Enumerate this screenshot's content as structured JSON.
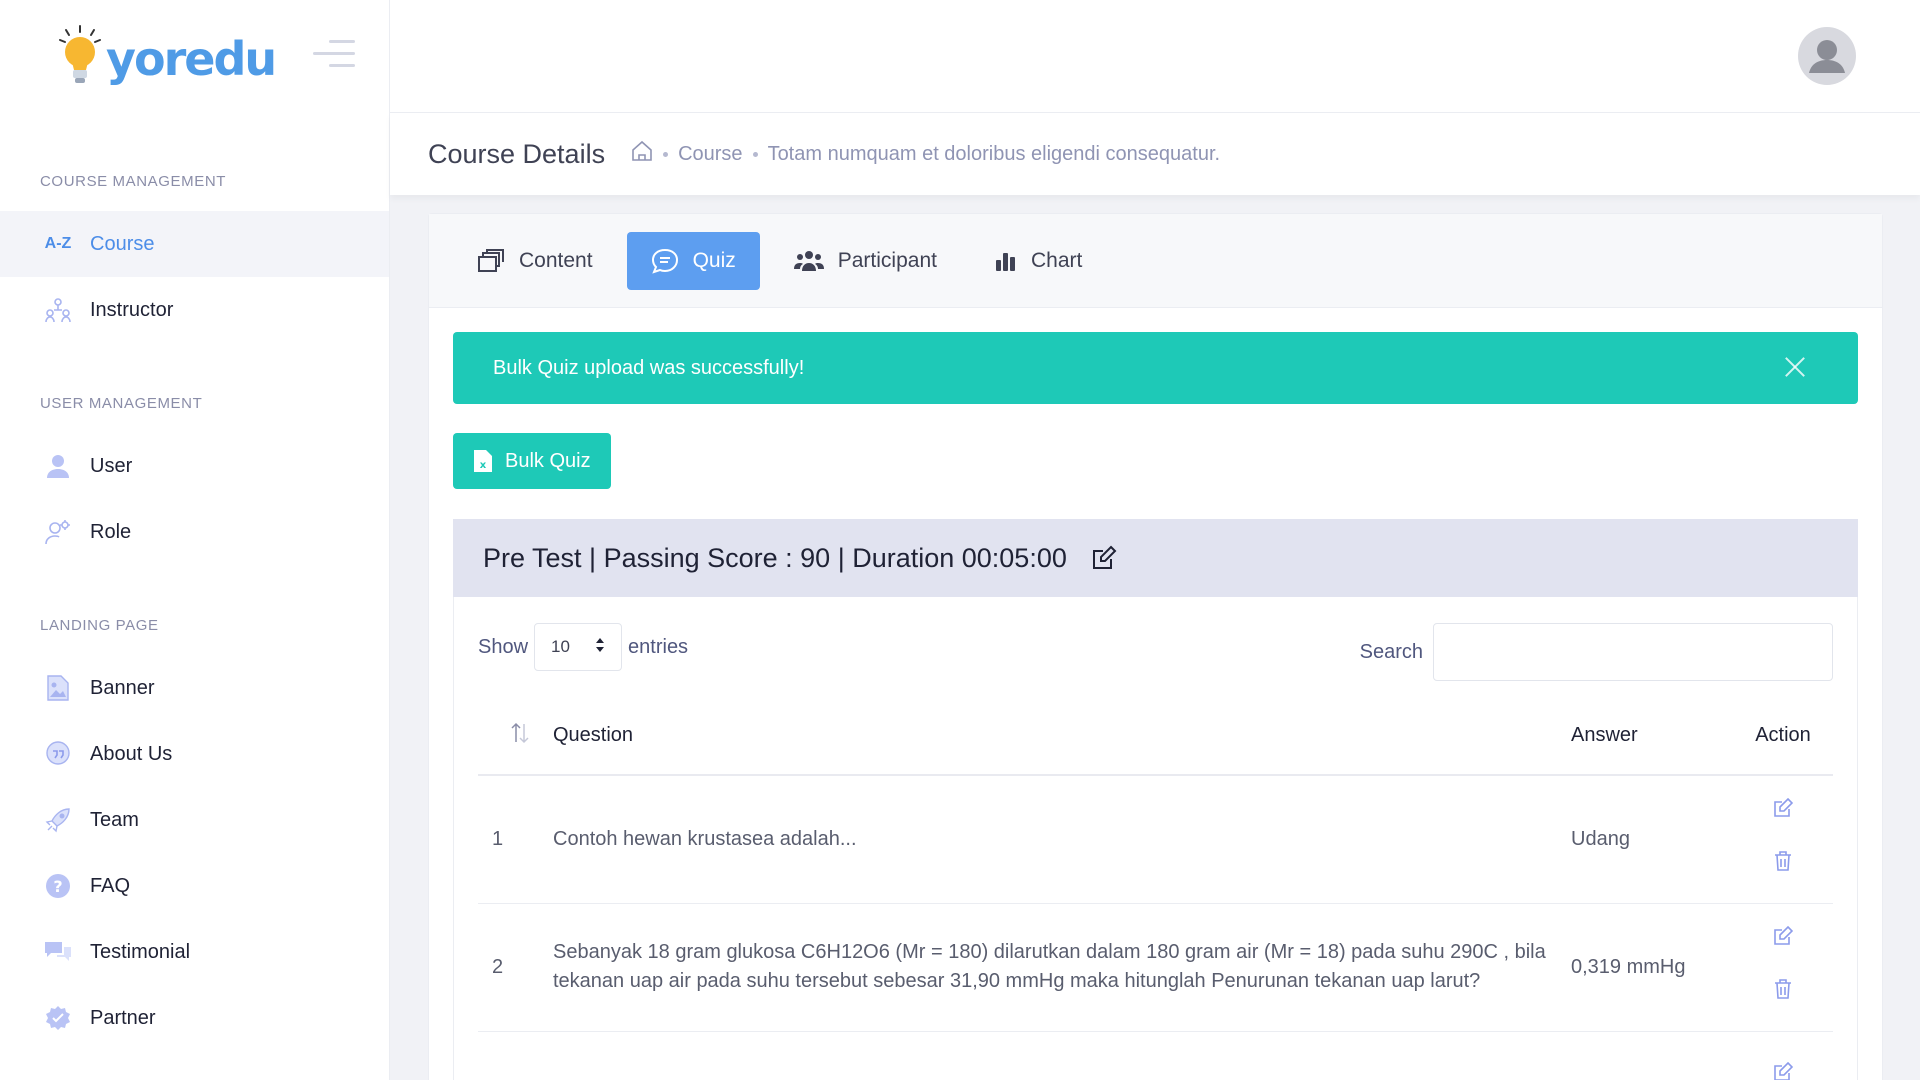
{
  "brand": {
    "name": "yoredu"
  },
  "sidebar": {
    "sections": [
      {
        "title": "COURSE MANAGEMENT"
      },
      {
        "title": "USER MANAGEMENT"
      },
      {
        "title": "LANDING PAGE"
      }
    ],
    "items": [
      {
        "label": "Course",
        "icon": "az-icon",
        "active": true
      },
      {
        "label": "Instructor",
        "icon": "people-tree-icon"
      },
      {
        "label": "User",
        "icon": "user-icon"
      },
      {
        "label": "Role",
        "icon": "user-gear-icon"
      },
      {
        "label": "Banner",
        "icon": "image-file-icon"
      },
      {
        "label": "About Us",
        "icon": "quote-bubble-icon"
      },
      {
        "label": "Team",
        "icon": "rocket-icon"
      },
      {
        "label": "FAQ",
        "icon": "question-icon"
      },
      {
        "label": "Testimonial",
        "icon": "chat-icon"
      },
      {
        "label": "Partner",
        "icon": "badge-check-icon"
      }
    ]
  },
  "subheader": {
    "title": "Course Details",
    "breadcrumb": [
      "Course",
      "Totam numquam et doloribus eligendi consequatur."
    ]
  },
  "tabs": [
    {
      "label": "Content",
      "icon": "copy-icon"
    },
    {
      "label": "Quiz",
      "icon": "chat-bubble-icon",
      "active": true
    },
    {
      "label": "Participant",
      "icon": "users-icon"
    },
    {
      "label": "Chart",
      "icon": "bar-chart-icon"
    }
  ],
  "alert": {
    "message": "Bulk Quiz upload was successfully!"
  },
  "bulk_button": {
    "label": "Bulk Quiz"
  },
  "quiz": {
    "header": "Pre Test | Passing Score : 90 | Duration 00:05:00",
    "length": {
      "show": "Show",
      "value": "10",
      "entries": "entries"
    },
    "search_label": "Search",
    "columns": {
      "question": "Question",
      "answer": "Answer",
      "action": "Action"
    },
    "rows": [
      {
        "no": "1",
        "question": "Contoh hewan krustasea adalah...",
        "answer": "Udang"
      },
      {
        "no": "2",
        "question": "Sebanyak 18 gram glukosa C6H12O6 (Mr = 180) dilarutkan dalam 180 gram air (Mr = 18) pada suhu 290C , bila tekanan uap air pada suhu tersebut sebesar 31,90 mmHg maka hitunglah Penurunan tekanan uap larut?",
        "answer": "0,319 mmHg"
      }
    ]
  },
  "colors": {
    "primary": "#5d9ef0",
    "success": "#1ec9b7",
    "quiz_header_bg": "#e1e3f0"
  }
}
